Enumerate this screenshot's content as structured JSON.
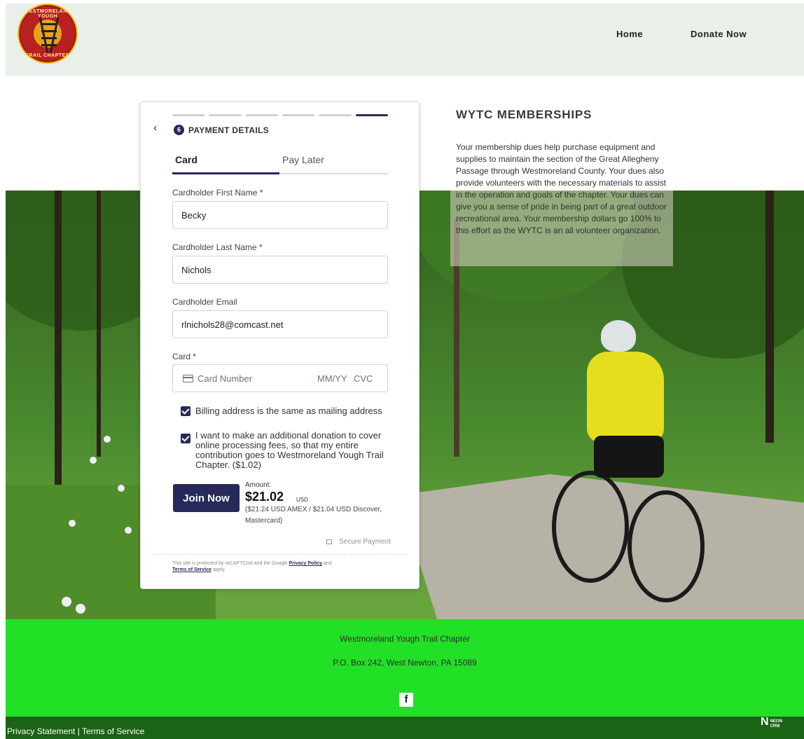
{
  "logo": {
    "top_text": "WESTMORELAND YOUGH",
    "bottom_text": "TRAIL CHAPTER"
  },
  "nav": {
    "home": "Home",
    "donate": "Donate Now"
  },
  "memberships": {
    "title": "WYTC MEMBERSHIPS",
    "text": "Your membership dues help purchase equipment and supplies to maintain the section of the Great Allegheny Passage through Westmoreland County.  Your dues also provide volunteers with the necessary materials to assist in the operation and goals of the chapter.  Your dues can give you a sense of pride in being part of a great outdoor recreational area.  Your membership dollars go 100% to this effort as the WYTC is an all volunteer organization."
  },
  "payment": {
    "step_number": "6",
    "step_title": "PAYMENT DETAILS",
    "tabs": {
      "card": "Card",
      "later": "Pay Later"
    },
    "first_name_label": "Cardholder First Name *",
    "first_name_value": "Becky",
    "last_name_label": "Cardholder Last Name *",
    "last_name_value": "Nichols",
    "email_label": "Cardholder Email",
    "email_value": "rlnichols28@comcast.net",
    "card_label": "Card *",
    "card_placeholder": "Card Number",
    "card_expiry_placeholder": "MM/YY",
    "card_cvc_placeholder": "CVC",
    "billing_checkbox": "Billing address is the same as mailing address",
    "donation_checkbox": "I want to make an additional donation to cover online processing fees, so that my entire contribution goes to Westmoreland Yough Trail Chapter. ($1.02)",
    "join_button": "Join Now",
    "amount_label": "Amount:",
    "amount_value": "$21.02",
    "amount_currency": "USD",
    "amount_note": "($21.24 USD AMEX / $21.04 USD Discover, Mastercard)",
    "secure_label": "Secure Payment",
    "recaptcha_prefix": "This site is protected by reCAPTCHA and the Google ",
    "privacy_policy": "Privacy Policy",
    "recaptcha_mid": " and ",
    "terms_of_service": "Terms of Service",
    "recaptcha_suffix": " apply."
  },
  "footer": {
    "org_name": "Westmoreland Yough Trail Chapter",
    "address": "P.O. Box 242, West Newton, PA   15089",
    "facebook": "f",
    "privacy_links": "Privacy Statement | Terms of Service",
    "neon_line1": "NEON",
    "neon_line2": "CRM"
  },
  "colors": {
    "accent": "#27295b",
    "footer": "#22e026",
    "subfooter": "#1b6315",
    "header": "#e9efe9"
  }
}
